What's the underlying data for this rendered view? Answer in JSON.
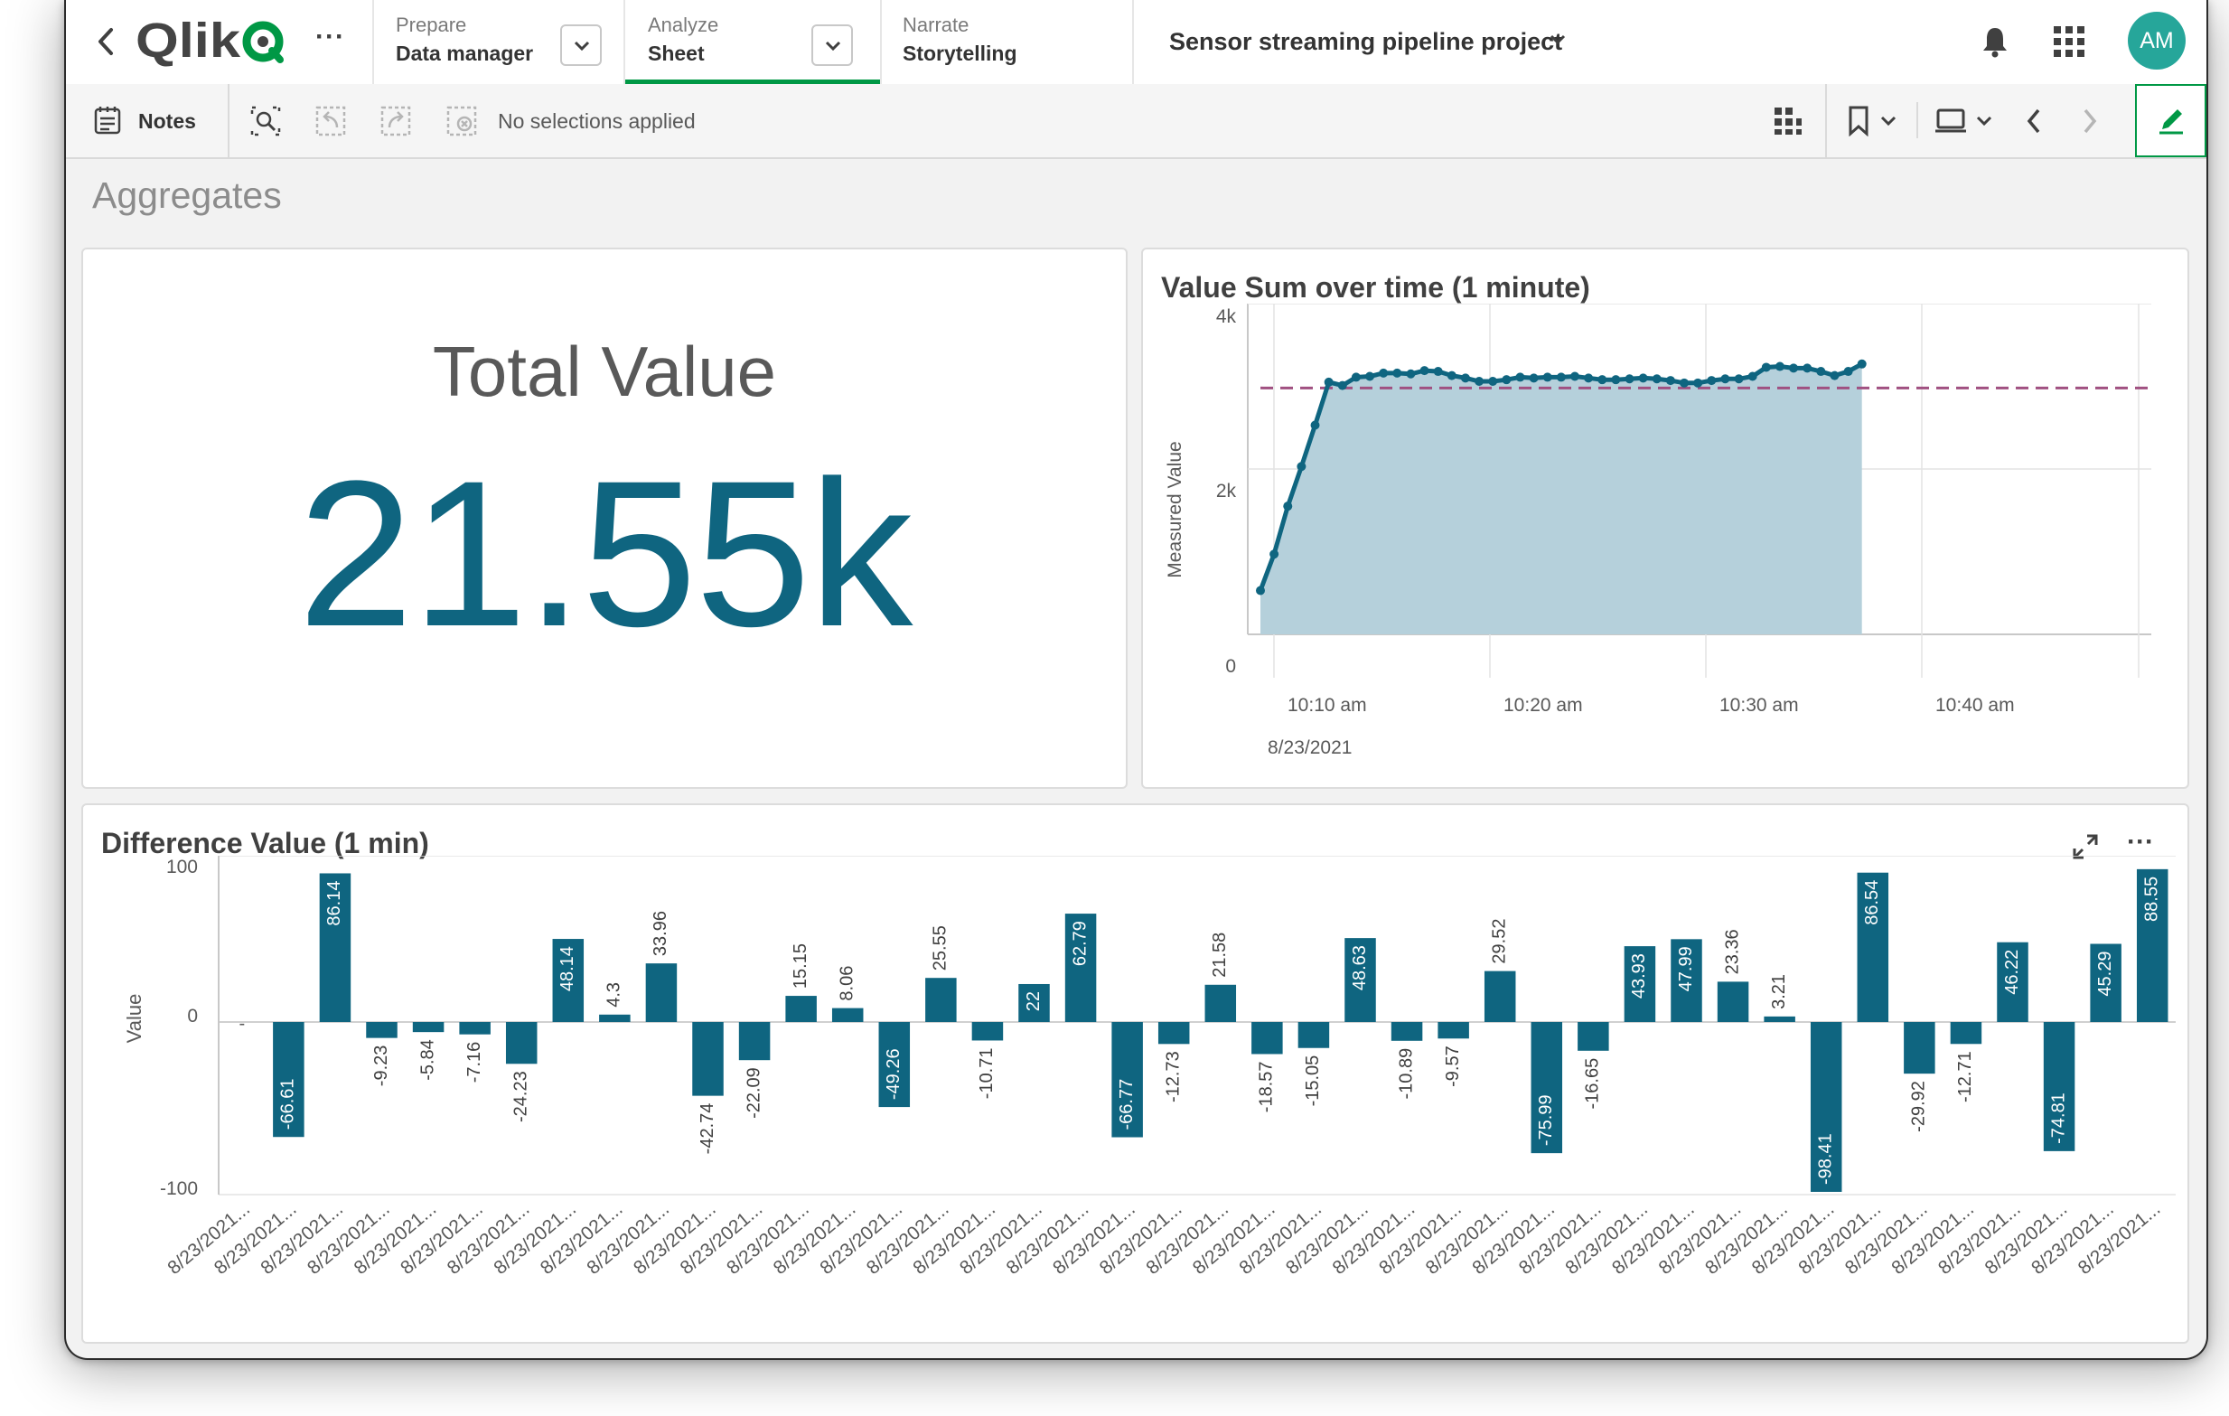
{
  "header": {
    "brand": "Qlik",
    "more_label": "···",
    "tabs": [
      {
        "small": "Prepare",
        "big": "Data manager"
      },
      {
        "small": "Analyze",
        "big": "Sheet"
      },
      {
        "small": "Narrate",
        "big": "Storytelling"
      }
    ],
    "app_title": "Sensor streaming pipeline project",
    "avatar": "AM"
  },
  "toolbar": {
    "notes_label": "Notes",
    "selections_text": "No selections applied"
  },
  "sheet": {
    "title": "Aggregates"
  },
  "kpi": {
    "label": "Total Value",
    "value": "21.55k"
  },
  "colors": {
    "accent": "#0f6580",
    "area": "#b5d0db",
    "reference": "#a05081",
    "active_green": "#009845"
  },
  "line_chart": {
    "title": "Value Sum over time (1 minute)",
    "ylabel": "Measured Value",
    "yticks": [
      "0",
      "2k",
      "4k"
    ],
    "xticks": [
      "10:10 am",
      "10:20 am",
      "10:30 am",
      "10:40 am"
    ],
    "date_label": "8/23/2021"
  },
  "bar_chart": {
    "title": "Difference Value (1 min)",
    "ylabel": "Value",
    "yticks": [
      "-100",
      "0",
      "100"
    ],
    "category_label": "8/23/2021..."
  },
  "chart_data": [
    {
      "type": "area",
      "title": "Value Sum over time (1 minute)",
      "ylabel": "Measured Value",
      "ylim": [
        0,
        4000
      ],
      "x_start": "10:06 am",
      "x_step_minutes": 1,
      "values": [
        530,
        970,
        1550,
        2030,
        2530,
        3050,
        3010,
        3110,
        3120,
        3160,
        3160,
        3150,
        3190,
        3180,
        3130,
        3100,
        3060,
        3060,
        3080,
        3110,
        3100,
        3110,
        3110,
        3120,
        3100,
        3080,
        3080,
        3090,
        3100,
        3090,
        3070,
        3040,
        3040,
        3070,
        3090,
        3090,
        3120,
        3230,
        3240,
        3220,
        3220,
        3180,
        3130,
        3180,
        3270
      ],
      "reference_line": 2980,
      "grid": true
    },
    {
      "type": "bar",
      "title": "Difference Value (1 min)",
      "ylabel": "Value",
      "ylim": [
        -100,
        100
      ],
      "values": [
        null,
        -66.61,
        86.14,
        -9.23,
        -5.84,
        -7.16,
        -24.23,
        48.14,
        4.3,
        33.96,
        -42.74,
        -22.09,
        15.15,
        8.06,
        -49.26,
        25.55,
        -10.71,
        22,
        62.79,
        -66.77,
        -12.73,
        21.58,
        -18.57,
        -15.05,
        48.63,
        -10.89,
        -9.57,
        29.52,
        -75.99,
        -16.65,
        43.93,
        47.99,
        23.36,
        3.21,
        -98.41,
        86.54,
        -29.92,
        -12.71,
        46.22,
        -74.81,
        45.29,
        88.55
      ],
      "null_label": "-",
      "grid": true
    }
  ]
}
